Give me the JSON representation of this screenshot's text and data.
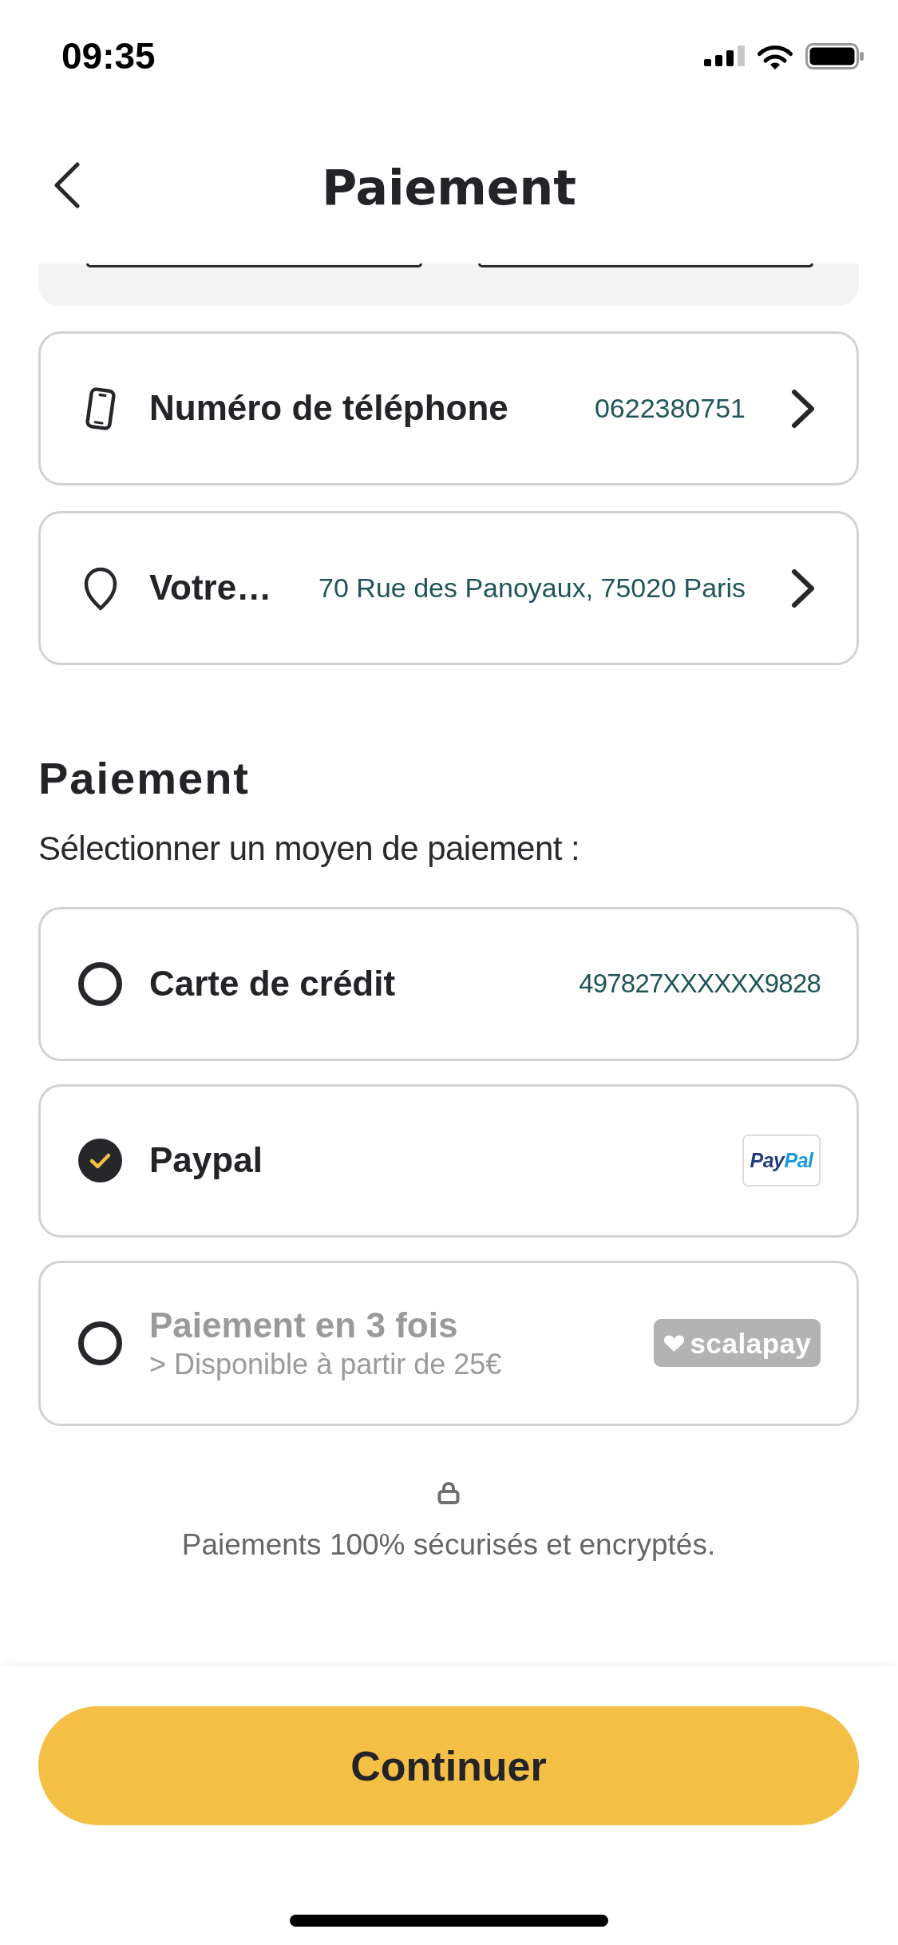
{
  "status_bar": {
    "time": "09:35"
  },
  "header": {
    "title": "Paiement"
  },
  "top_panel": {
    "buttons": [
      {
        "kind": "outlined"
      },
      {
        "kind": "outlined"
      }
    ]
  },
  "contact_rows": [
    {
      "kind": "phone",
      "label": "Numéro de téléphone",
      "value": "0622380751"
    },
    {
      "kind": "address",
      "label": "Votre…",
      "value": "70 Rue des Panoyaux, 75020 Paris"
    }
  ],
  "payment": {
    "title": "Paiement",
    "subtitle": "Sélectionner un moyen de paiement :",
    "methods": [
      {
        "kind": "card",
        "label": "Carte de crédit",
        "value": "497827XXXXXX9828",
        "selected": false,
        "disabled": false
      },
      {
        "kind": "paypal",
        "label": "Paypal",
        "logo": [
          "Pay",
          "Pal"
        ],
        "selected": true,
        "disabled": false
      },
      {
        "kind": "installments",
        "label": "Paiement en 3 fois",
        "note": "> Disponible à partir de 25€",
        "logo": [
          "scalapay"
        ],
        "selected": false,
        "disabled": true
      }
    ]
  },
  "security": {
    "text": "Paiements 100% sécurisés et encryptés."
  },
  "footer": {
    "button": "Continuer"
  }
}
